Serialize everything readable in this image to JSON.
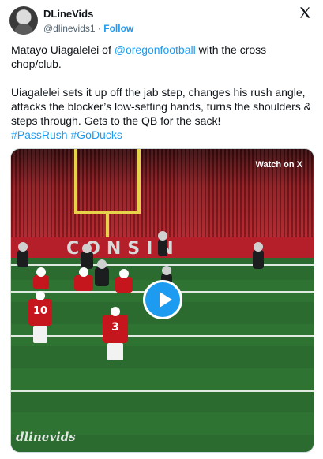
{
  "author": {
    "display_name": "DLineVids",
    "handle": "@dlinevids1",
    "separator": "·",
    "follow_label": "Follow"
  },
  "tweet": {
    "line1_before": "Matayo Uiagalelei of ",
    "mention": "@oregonfootball",
    "line1_after": " with the cross chop/club.",
    "paragraph2": "Uiagalelei sets it up off the jab step, changes his rush angle, attacks the blocker’s low-setting hands, turns the shoulders & steps through. Gets to the QB for the sack!",
    "hashtag1": "#PassRush",
    "hashtag2": "#GoDucks"
  },
  "media": {
    "watch_label": "Watch on X",
    "watermark": "dlinevids",
    "wall_text": "CONSIN",
    "jersey_numbers": [
      "10",
      "3"
    ]
  },
  "colors": {
    "link": "#1d9bf0",
    "text": "#0f1419",
    "muted": "#536471",
    "team_red": "#c4161c"
  },
  "icons": {
    "platform_logo": "x-logo-icon",
    "play": "play-icon"
  }
}
